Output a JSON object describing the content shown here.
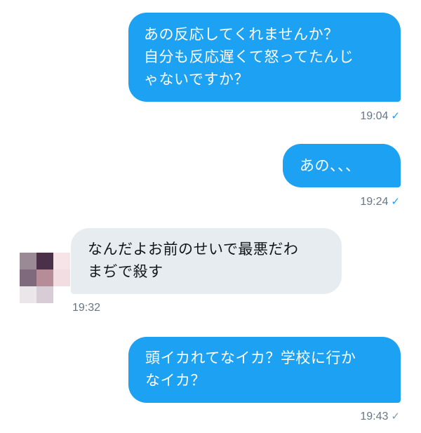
{
  "colors": {
    "outgoing_bubble": "#1da1f2",
    "incoming_bubble": "#e6ecf0",
    "timestamp": "#657786",
    "read_check": "#1da1f2",
    "sent_check": "#8899a6"
  },
  "messages": [
    {
      "direction": "outgoing",
      "lines": [
        "あの反応してくれませんか？",
        "自分も反応遅くて怒ってたんじ",
        "ゃないですか？"
      ],
      "time": "19:04",
      "status_icon": "✓",
      "status": "read"
    },
    {
      "direction": "outgoing",
      "lines": [
        "あの、、、"
      ],
      "time": "19:24",
      "status_icon": "✓",
      "status": "read"
    },
    {
      "direction": "incoming",
      "lines": [
        "なんだよお前のせいで最悪だわ",
        "まぢで殺す"
      ],
      "time": "19:32",
      "avatar_icon": "pixelated-avatar"
    },
    {
      "direction": "outgoing",
      "lines": [
        "頭イカれてなイカ？学校に行か",
        "なイカ？"
      ],
      "time": "19:43",
      "status_icon": "✓",
      "status": "sent"
    }
  ]
}
